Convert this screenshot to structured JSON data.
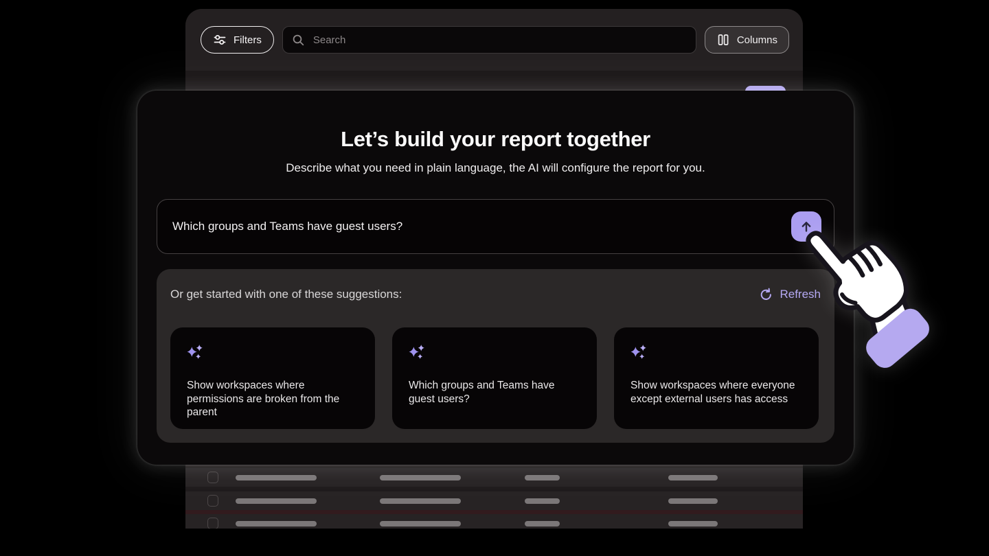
{
  "toolbar": {
    "filters_label": "Filters",
    "search_placeholder": "Search",
    "columns_label": "Columns"
  },
  "modal": {
    "title": "Let’s build your report together",
    "subtitle": "Describe what you need in plain language, the AI will configure the report for you.",
    "prompt": {
      "value": "Which groups and Teams have guest users?",
      "submit_icon": "arrow-up-icon"
    },
    "suggestions": {
      "header": "Or get started with one of these suggestions:",
      "refresh_label": "Refresh",
      "cards": [
        {
          "icon": "sparkles-icon",
          "text": "Show workspaces where permissions are broken from the parent"
        },
        {
          "icon": "sparkles-icon",
          "text": "Which groups and Teams have guest users?"
        },
        {
          "icon": "sparkles-icon",
          "text": "Show workspaces where everyone except external users has access"
        }
      ]
    }
  },
  "background_table": {
    "skeleton_row_count": 3,
    "has_row_checkboxes": true
  },
  "icons": {
    "filters": "sliders-icon",
    "search": "magnifier-icon",
    "columns": "two-columns-icon",
    "refresh": "refresh-arrow-icon",
    "submit": "arrow-up-icon",
    "cards": "sparkles-icon",
    "cursor": "pointing-hand-cursor"
  },
  "colors": {
    "accent_purple": "#ab9ef1",
    "refresh_purple": "#b5a9f3",
    "sparkle_purple": "#9f93ee",
    "modal_bg": "#0b090a",
    "panel_bg": "#2b2828",
    "card_bg": "#070506",
    "toolbar_bg": "#242021",
    "skeleton_bar": "#7b7778"
  }
}
